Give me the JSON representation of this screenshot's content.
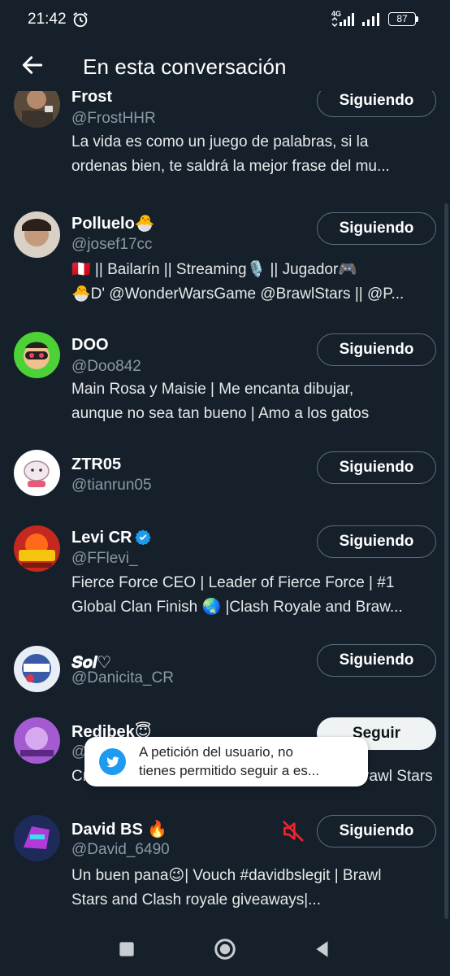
{
  "status_bar": {
    "time": "21:42",
    "network": "4G",
    "battery": "87"
  },
  "header": {
    "title": "En esta conversación"
  },
  "users": [
    {
      "name": "Frost",
      "handle": "@FrostHHR",
      "button": "Siguiendo",
      "bio": [
        "La vida es como un juego de palabras, si la",
        "ordenas bien, te saldrá la mejor frase del mu..."
      ]
    },
    {
      "name": "Polluelo🐣",
      "handle": "@josef17cc",
      "button": "Siguiendo",
      "bio": [
        "🇵🇪 || Bailarín || Streaming🎙️ || Jugador🎮",
        "🐣D' @WonderWarsGame @BrawlStars || @P..."
      ]
    },
    {
      "name": "DOO",
      "handle": "@Doo842",
      "button": "Siguiendo",
      "bio": [
        "Main Rosa y Maisie | Me encanta dibujar,",
        "aunque no sea tan bueno | Amo a los gatos"
      ]
    },
    {
      "name": "ZTR05",
      "handle": "@tianrun05",
      "button": "Siguiendo",
      "bio": []
    },
    {
      "name": "Levi CR",
      "handle": "@FFlevi_",
      "button": "Siguiendo",
      "bio": [
        "Fierce Force CEO | Leader of Fierce Force | #1",
        "Global Clan Finish 🌏 |Clash Royale and Braw..."
      ]
    },
    {
      "name": "𝑺𝒐𝒍♡",
      "handle": "@Danicita_CR",
      "button": "Siguiendo",
      "bio": []
    },
    {
      "name": "Redibek😇",
      "handle": "@",
      "button": "Seguir",
      "bio": [
        "Creador de contenido de Clash Royale y Brawl Stars"
      ]
    },
    {
      "name": "David BS 🔥",
      "handle": "@David_6490",
      "button": "Siguiendo",
      "bio": [
        "Un buen pana😉| Vouch #davidbslegit | Brawl",
        "Stars and Clash royale giveaways|..."
      ]
    }
  ],
  "toast": {
    "lines": [
      "A petición del usuario, no",
      "tienes permitido seguir a es..."
    ]
  },
  "icons": {
    "back": "arrow-left-icon",
    "verified": "verified-badge-icon",
    "mute": "muted-icon",
    "toast": "twitter-bird-icon"
  },
  "colors": {
    "background": "#15202b",
    "secondary_text": "#8b98a5",
    "verified": "#1d9bf0",
    "mute": "#f4212e"
  }
}
